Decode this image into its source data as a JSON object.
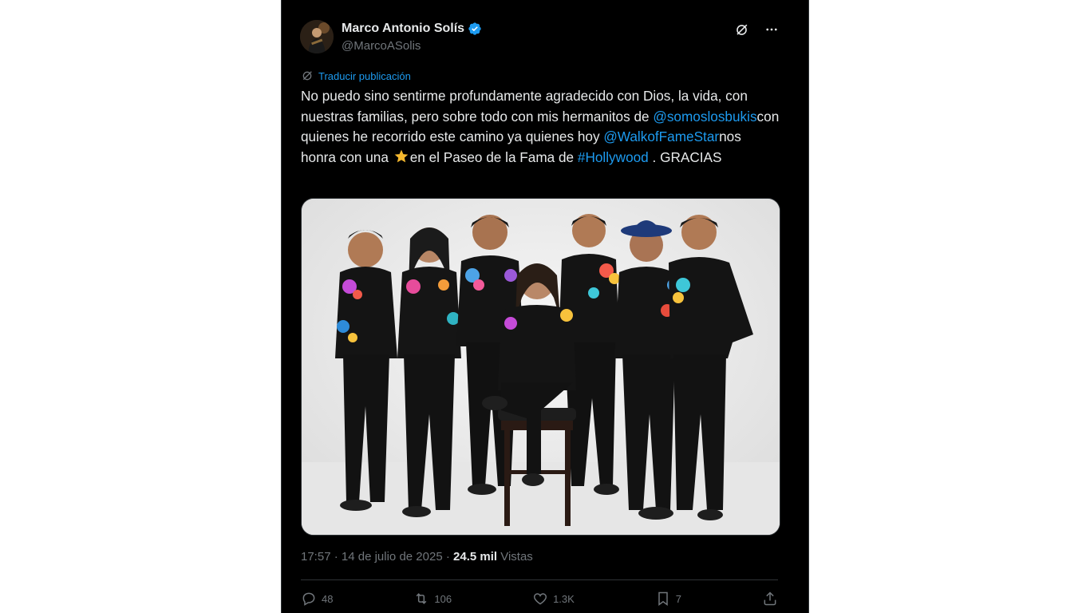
{
  "author": {
    "display_name": "Marco Antonio Solís",
    "handle": "@MarcoASolis",
    "verified": true
  },
  "translate_label": "Traducir publicación",
  "tweet": {
    "text_1": "No puedo sino sentirme profundamente agradecido con Dios, la vida, con nuestras familias, pero sobre todo con mis hermanitos de ",
    "mention_1": "@somoslosbukis",
    "text_2": "con quienes he recorrido este camino ya quienes hoy ",
    "mention_2": "@WalkofFameStar",
    "text_3": "nos honra con una ",
    "star_emoji": "star",
    "text_4": "en el Paseo de la Fama de ",
    "hashtag": "#Hollywood",
    "text_5": " . GRACIAS"
  },
  "meta": {
    "time": "17:57",
    "sep1": " · ",
    "date": "14 de julio de 2025",
    "sep2": " · ",
    "views_count": "24.5 mil",
    "views_label": " Vistas"
  },
  "actions": {
    "replies": "48",
    "reposts": "106",
    "likes": "1.3K",
    "bookmarks": "7"
  },
  "icons": [
    "verified-badge-icon",
    "grok-icon",
    "more-icon",
    "translate-icon",
    "reply-icon",
    "repost-icon",
    "like-icon",
    "bookmark-icon",
    "share-icon"
  ],
  "colors": {
    "background": "#000000",
    "text": "#e7e9ea",
    "muted": "#71767b",
    "link": "#1d9bf0"
  }
}
